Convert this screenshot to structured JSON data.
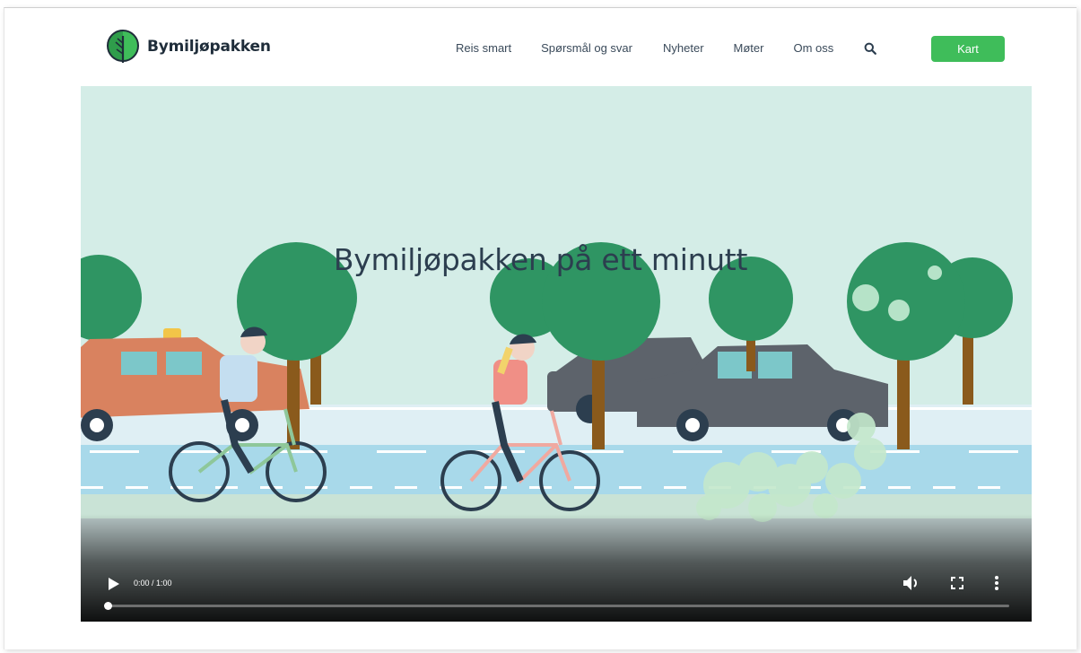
{
  "brand": {
    "name": "Bymiljøpakken",
    "logo_icon": "leaf-circle-icon",
    "logo_color": "#3fbd5a"
  },
  "nav": {
    "items": [
      "Reis smart",
      "Spørsmål og svar",
      "Nyheter",
      "Møter",
      "Om oss"
    ],
    "search_icon": "search-icon",
    "cta_label": "Kart",
    "cta_color": "#3fbd5a"
  },
  "video": {
    "title": "Bymiljøpakken på ett minutt",
    "time": "0:00 / 1:00",
    "progress": 0,
    "controls": {
      "play_icon": "play-icon",
      "volume_icon": "volume-icon",
      "fullscreen_icon": "fullscreen-icon",
      "more_icon": "more-vertical-icon"
    }
  }
}
